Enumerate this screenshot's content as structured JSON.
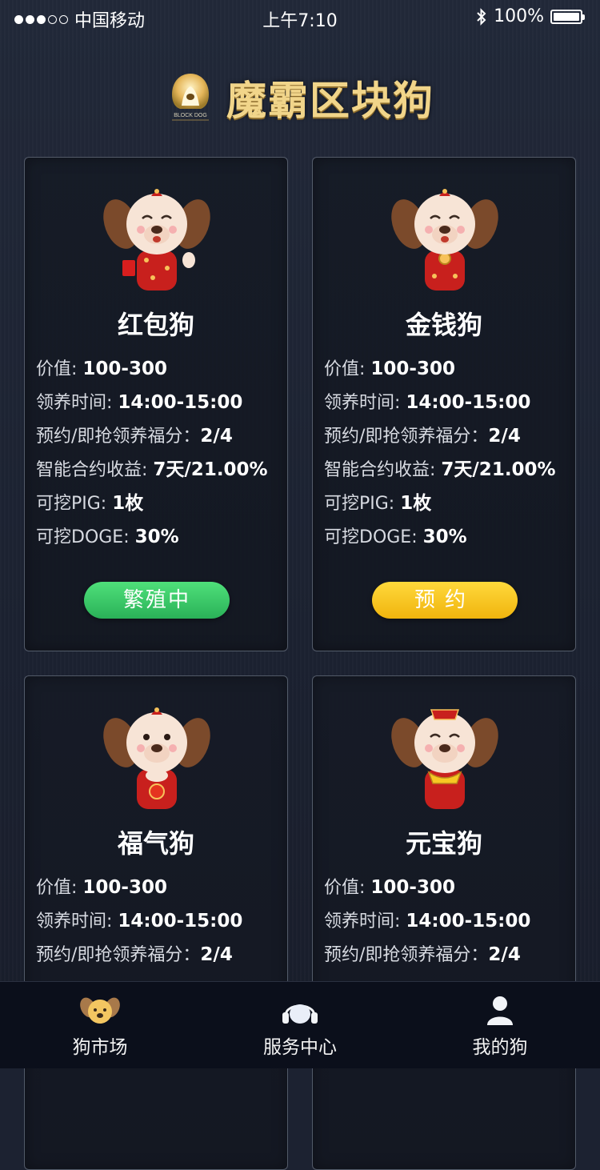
{
  "status_bar": {
    "carrier": "中国移动",
    "time": "上午7:10",
    "battery": "100%"
  },
  "header": {
    "logo_caption": "BLOCK DOG",
    "title": "魔霸区块狗"
  },
  "labels": {
    "value": "价值: ",
    "adopt_time": "领养时间: ",
    "reserve_points": "预约/即抢领养福分：",
    "contract_return": "智能合约收益: ",
    "mine_pig": "可挖PIG: ",
    "mine_doge": "可挖DOGE: "
  },
  "cards": [
    {
      "name": "红包狗",
      "value": "100-300",
      "adopt_time": "14:00-15:00",
      "reserve_points": "2/4",
      "contract_return": "7天/21.00%",
      "mine_pig": "1枚",
      "mine_doge": "30%",
      "button": "繁殖中"
    },
    {
      "name": "金钱狗",
      "value": "100-300",
      "adopt_time": "14:00-15:00",
      "reserve_points": "2/4",
      "contract_return": "7天/21.00%",
      "mine_pig": "1枚",
      "mine_doge": "30%",
      "button": "预约"
    },
    {
      "name": "福气狗",
      "value": "100-300",
      "adopt_time": "14:00-15:00",
      "reserve_points": "2/4"
    },
    {
      "name": "元宝狗",
      "value": "100-300",
      "adopt_time": "14:00-15:00",
      "reserve_points": "2/4"
    }
  ],
  "tabs": [
    {
      "label": "狗市场",
      "icon": "dog-face-icon"
    },
    {
      "label": "服务中心",
      "icon": "headset-icon"
    },
    {
      "label": "我的狗",
      "icon": "user-icon"
    }
  ],
  "colors": {
    "background": "#1c2231",
    "title_gold": "#f1d58a",
    "breeding_green": "#3ccb68",
    "reserve_yellow": "#f7c823"
  }
}
